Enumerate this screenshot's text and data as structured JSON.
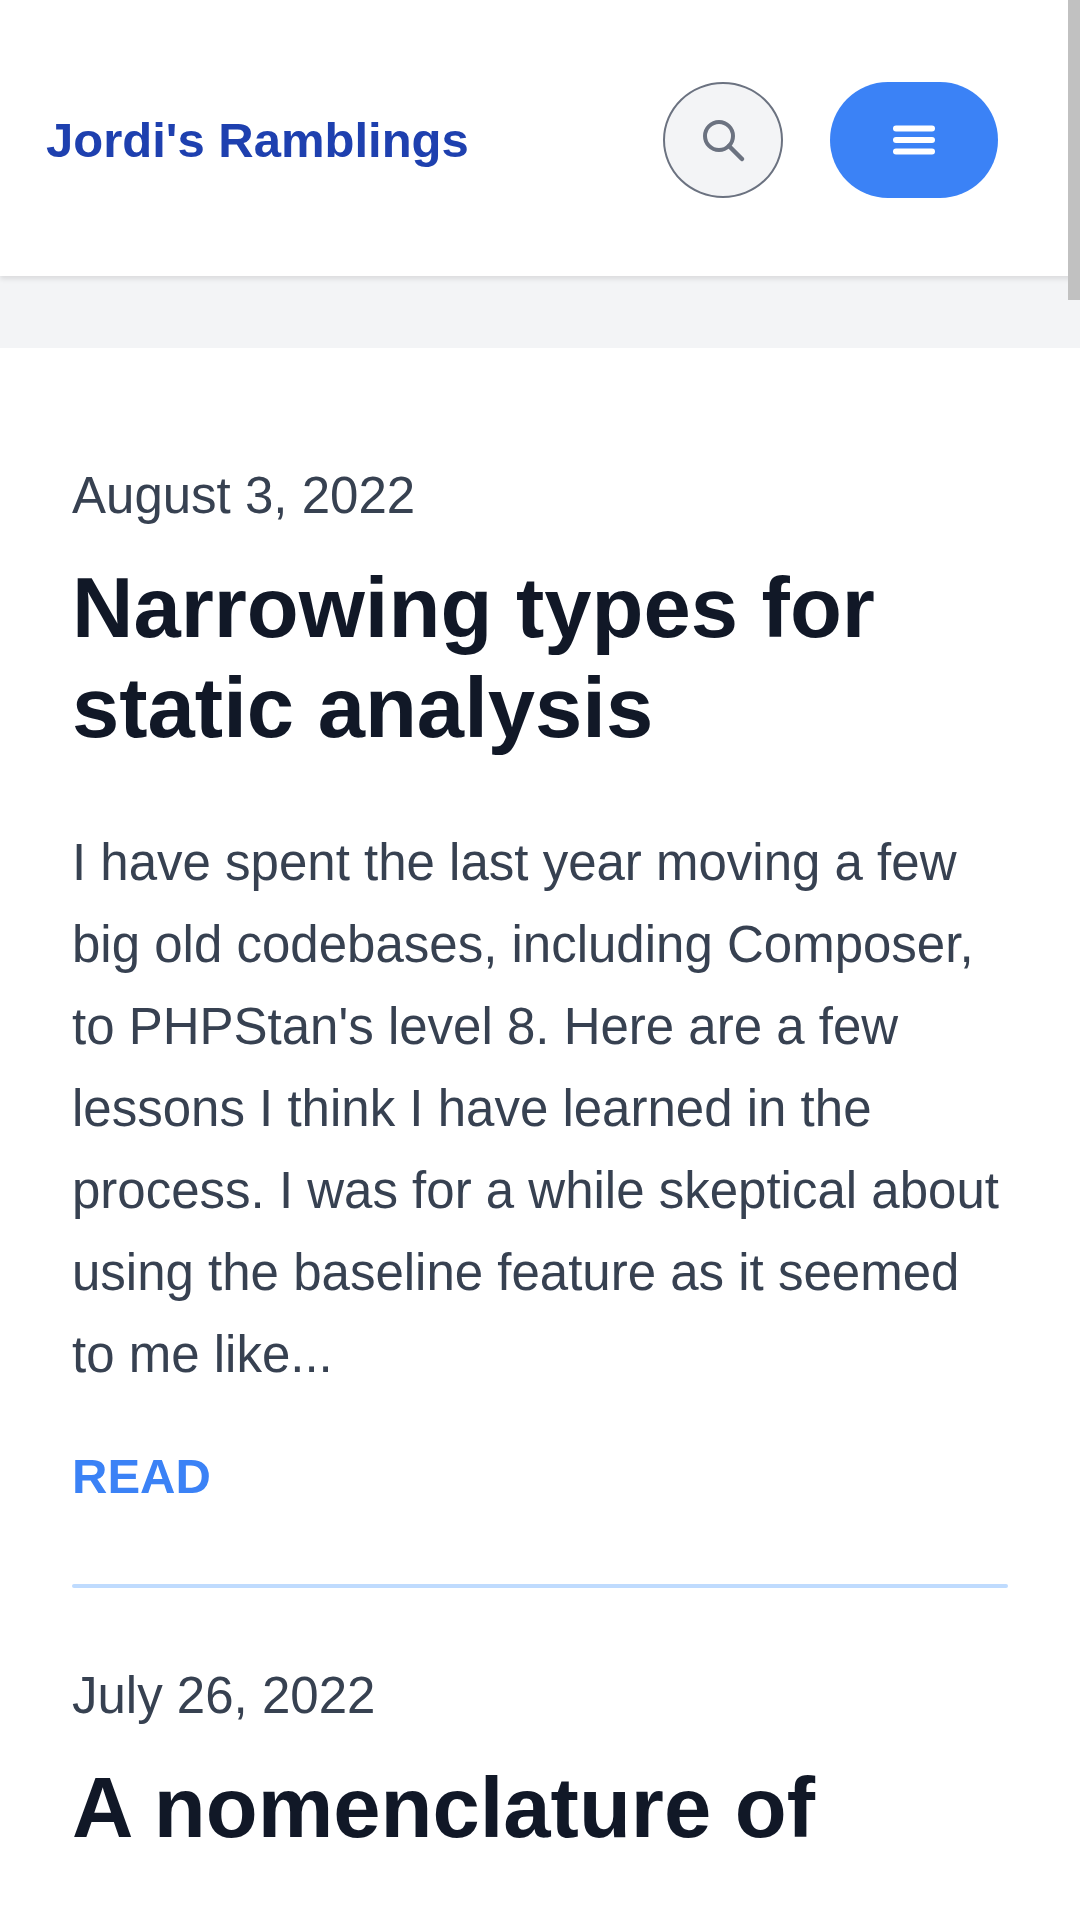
{
  "header": {
    "site_title": "Jordi's Ramblings"
  },
  "posts": [
    {
      "date": "August 3, 2022",
      "title": "Narrowing types for static analysis",
      "excerpt": "I have spent the last year moving a few big old codebases, including Composer, to PHPStan's level 8. Here are a few lessons I think I have learned in the process. I was for a while skeptical about using the baseline feature as it seemed to me like...",
      "link": "READ"
    },
    {
      "date": "July 26, 2022",
      "title": "A nomenclature of"
    }
  ]
}
